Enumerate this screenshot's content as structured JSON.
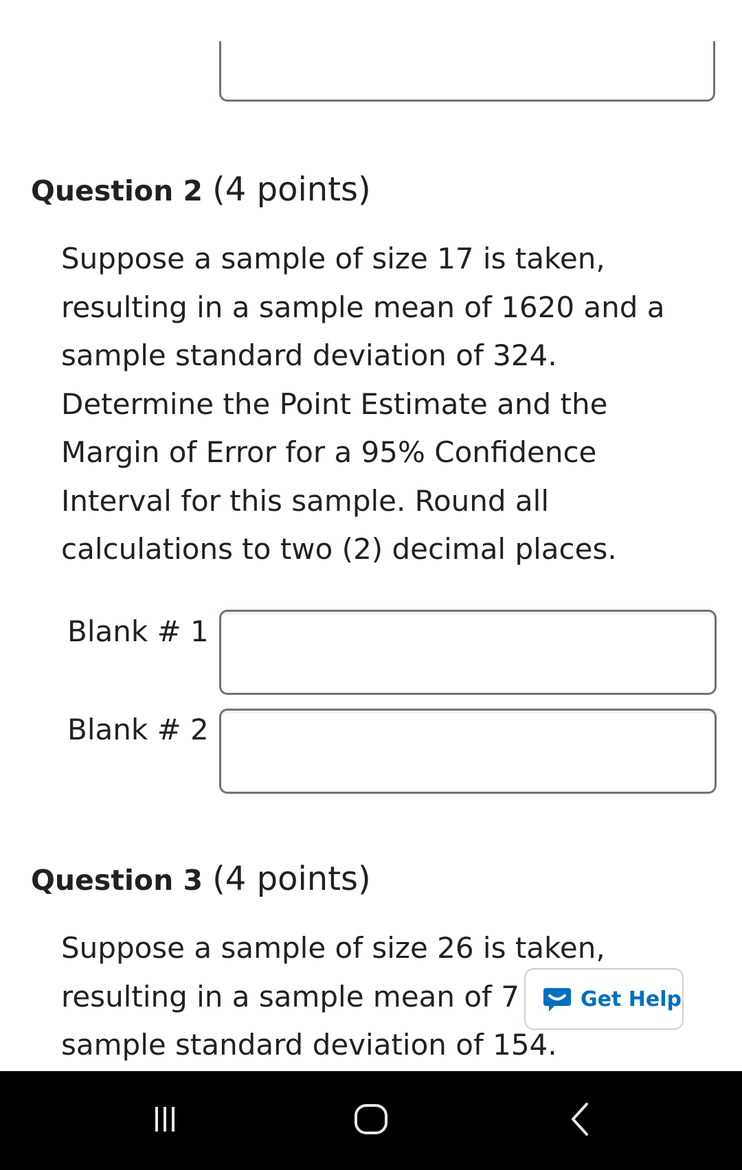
{
  "question2": {
    "number_label": "Question 2",
    "points_label": "(4 points)",
    "body_lines": [
      "Suppose a sample of size 17 is taken,",
      "resulting in a sample mean of 1620 and a",
      "sample standard deviation of 324.",
      "Determine the Point Estimate and the",
      "Margin of Error for a 95% Confidence",
      "Interval for this sample. Round all",
      "calculations to two (2) decimal places."
    ],
    "blanks": [
      {
        "label": "Blank # 1",
        "value": ""
      },
      {
        "label": "Blank # 2",
        "value": ""
      }
    ]
  },
  "question3": {
    "number_label": "Question 3",
    "points_label": "(4 points)",
    "body_lines": [
      "Suppose a sample of size 26 is taken,",
      "resulting in a sample mean of 7",
      "sample standard deviation of 154."
    ]
  },
  "get_help": {
    "label": "Get Help",
    "icon": "chat-bubble-icon",
    "color": "#006fbf"
  },
  "system_nav": {
    "recents_icon": "recents-icon",
    "home_icon": "home-icon",
    "back_icon": "back-icon"
  }
}
